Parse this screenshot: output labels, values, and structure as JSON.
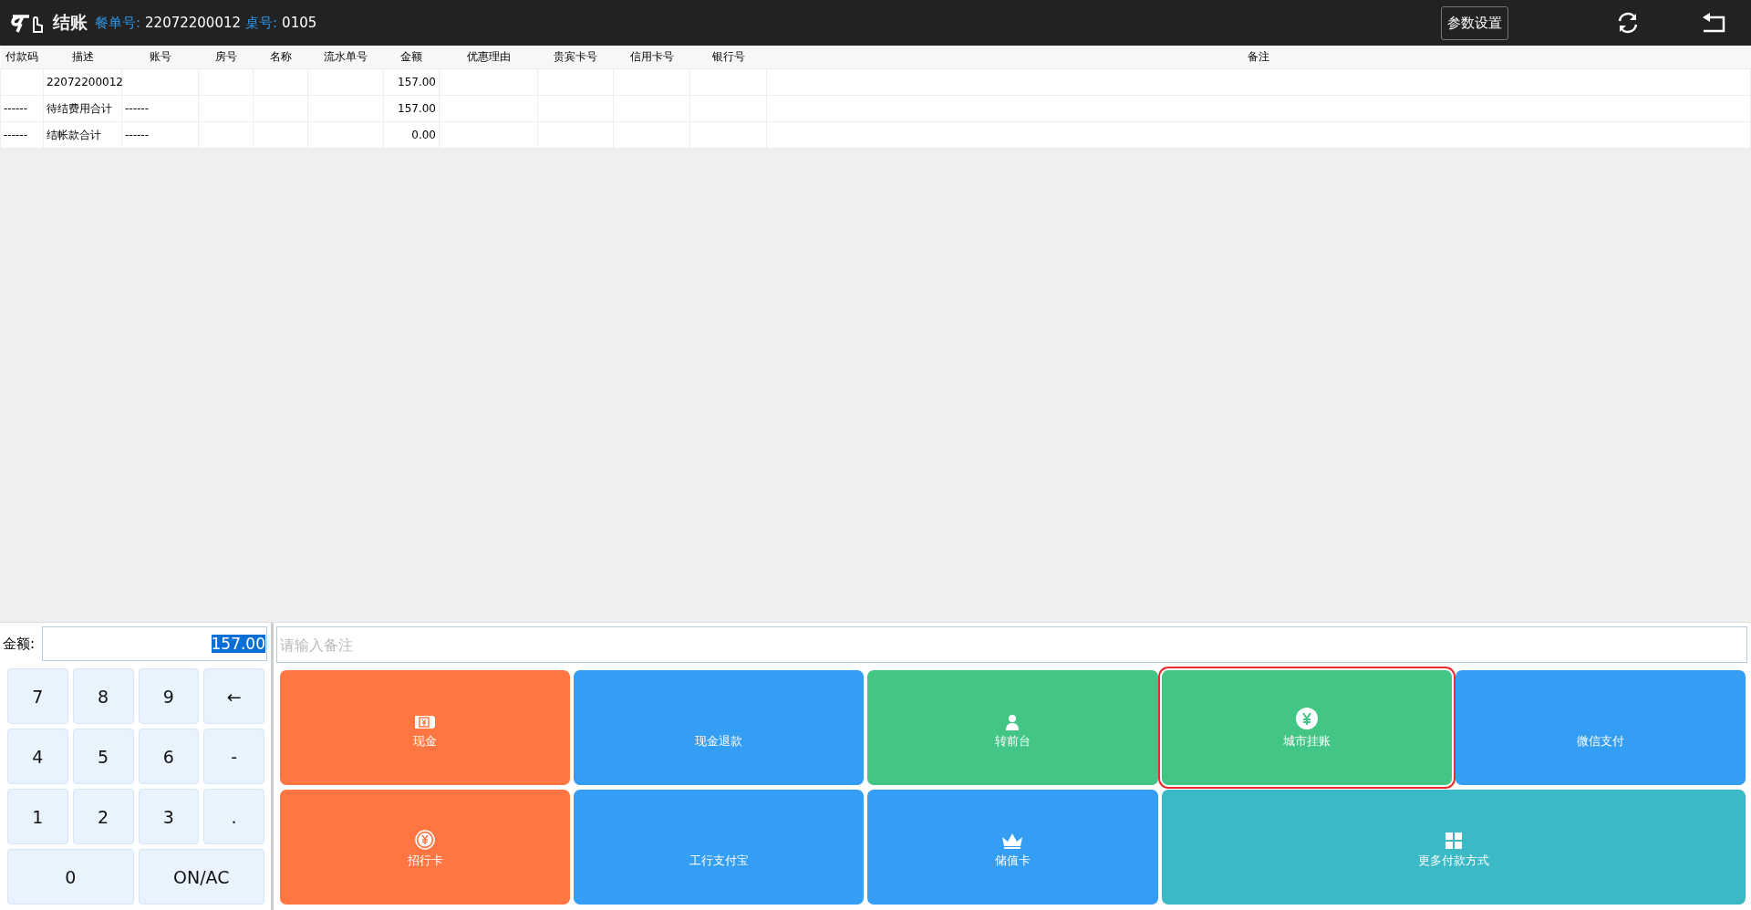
{
  "header": {
    "title": "结账",
    "order_label": "餐单号:",
    "order_no": "22072200012",
    "table_label": "桌号:",
    "table_no": "0105",
    "settings_button": "参数设置"
  },
  "table": {
    "columns": [
      "付款码",
      "描述",
      "账号",
      "房号",
      "名称",
      "流水单号",
      "金额",
      "优惠理由",
      "贵宾卡号",
      "信用卡号",
      "银行号",
      "备注"
    ],
    "rows": [
      [
        "",
        "22072200012",
        "",
        "",
        "",
        "",
        "157.00",
        "",
        "",
        "",
        "",
        ""
      ],
      [
        "------",
        "待结费用合计",
        "------",
        "",
        "",
        "",
        "157.00",
        "",
        "",
        "",
        "",
        ""
      ],
      [
        "------",
        "结帐款合计",
        "------",
        "",
        "",
        "",
        "0.00",
        "",
        "",
        "",
        "",
        ""
      ]
    ]
  },
  "amount": {
    "label": "金额:",
    "value": "157.00",
    "text_selected": true
  },
  "remark": {
    "placeholder": "请输入备注"
  },
  "keypad": [
    {
      "label": "7",
      "wide": false
    },
    {
      "label": "8",
      "wide": false
    },
    {
      "label": "9",
      "wide": false
    },
    {
      "label": "←",
      "wide": false
    },
    {
      "label": "4",
      "wide": false
    },
    {
      "label": "5",
      "wide": false
    },
    {
      "label": "6",
      "wide": false
    },
    {
      "label": "-",
      "wide": false
    },
    {
      "label": "1",
      "wide": false
    },
    {
      "label": "2",
      "wide": false
    },
    {
      "label": "3",
      "wide": false
    },
    {
      "label": ".",
      "wide": false
    },
    {
      "label": "0",
      "wide": true
    },
    {
      "label": "ON/AC",
      "wide": true
    }
  ],
  "payments": [
    {
      "label": "现金",
      "kind": "cash",
      "color": "#ff7643",
      "selected": false,
      "wide": false
    },
    {
      "label": "现金退款",
      "kind": "plain",
      "color": "#349df4",
      "selected": false,
      "wide": false
    },
    {
      "label": "转前台",
      "kind": "person",
      "color": "#43c586",
      "selected": false,
      "wide": false
    },
    {
      "label": "城市挂账",
      "kind": "coin",
      "color": "#43c586",
      "selected": true,
      "wide": false
    },
    {
      "label": "微信支付",
      "kind": "plain",
      "color": "#349df4",
      "selected": false,
      "wide": false
    },
    {
      "label": "招行卡",
      "kind": "yen-circle",
      "color": "#ff7643",
      "selected": false,
      "wide": false
    },
    {
      "label": "工行支付宝",
      "kind": "plain",
      "color": "#349df4",
      "selected": false,
      "wide": false
    },
    {
      "label": "储值卡",
      "kind": "crown",
      "color": "#349df4",
      "selected": false,
      "wide": false
    },
    {
      "label": "更多付款方式",
      "kind": "grid",
      "color": "#3bbac6",
      "selected": false,
      "wide": true
    }
  ]
}
